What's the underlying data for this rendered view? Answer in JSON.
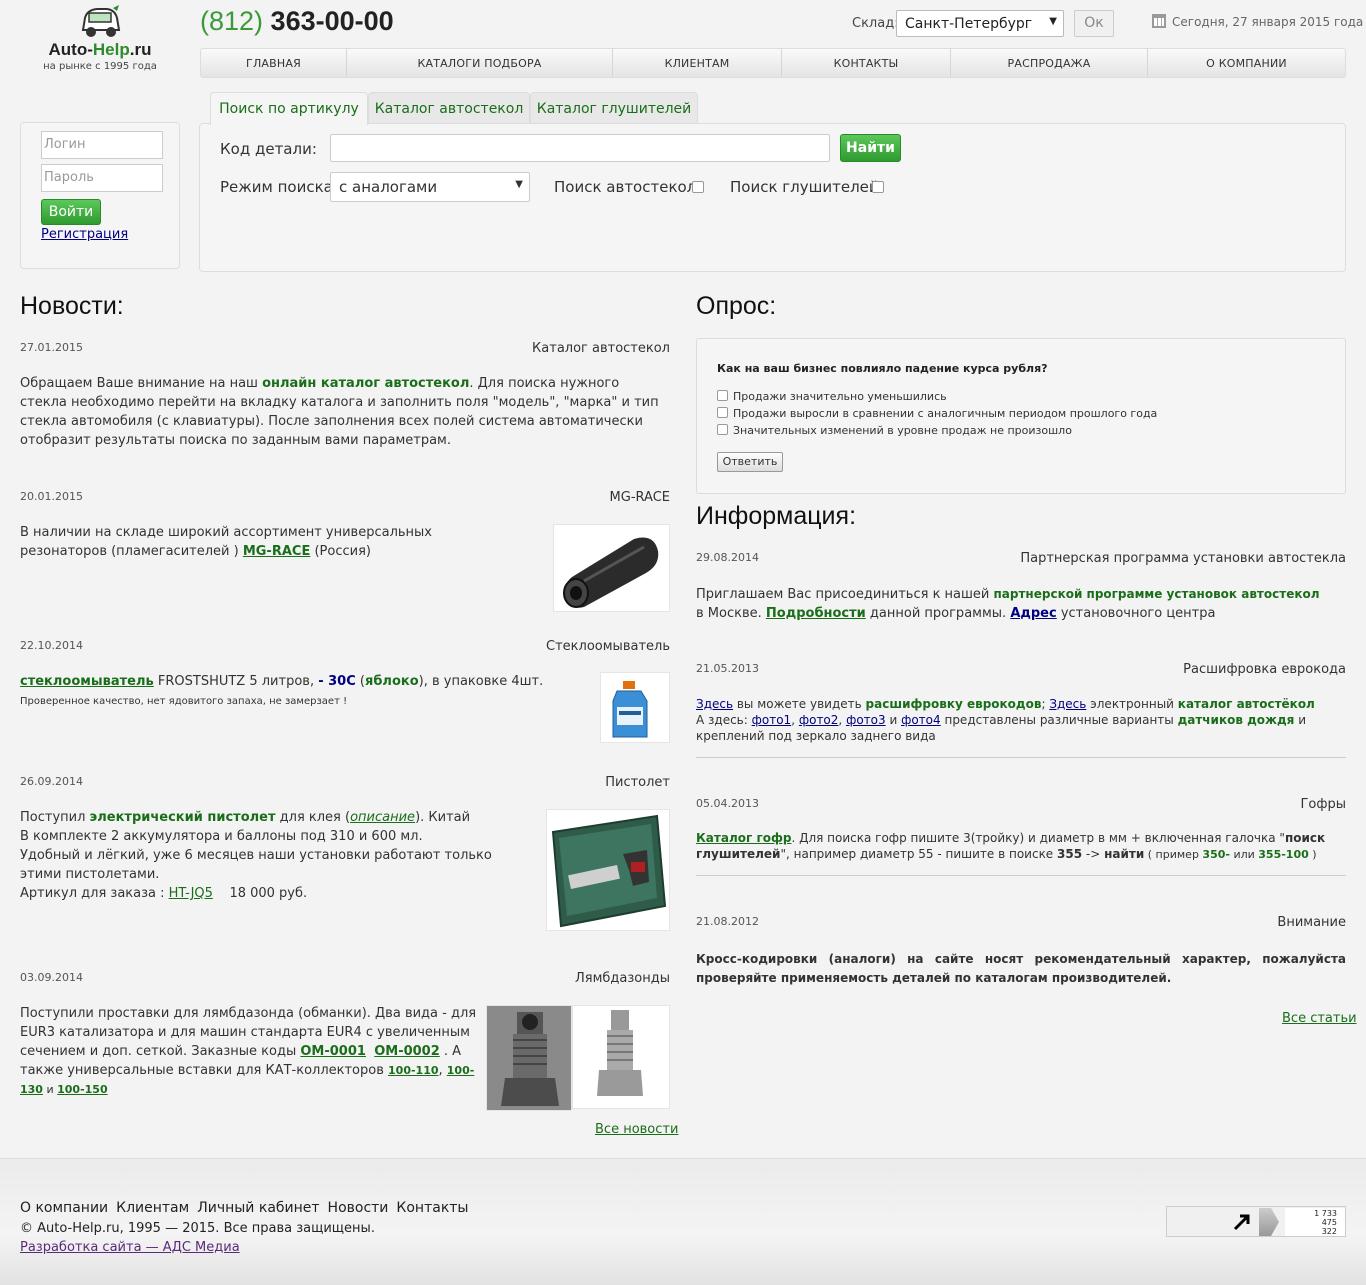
{
  "header": {
    "logo_name_a": "Auto-",
    "logo_name_b": "Help",
    "logo_name_c": ".ru",
    "logo_tagline": "на рынке с 1995 года",
    "phone_code": "(812)",
    "phone_number": "363-00-00",
    "warehouse_label": "Склад:",
    "warehouse_value": "Санкт-Петербург",
    "ok_label": "Ок",
    "date_text": "Сегодня, 27 января 2015 года"
  },
  "nav": [
    "ГЛАВНАЯ",
    "КАТАЛОГИ ПОДБОРА",
    "КЛИЕНТАМ",
    "КОНТАКТЫ",
    "РАСПРОДАЖА",
    "О КОМПАНИИ"
  ],
  "login": {
    "login_placeholder": "Логин",
    "password_placeholder": "Пароль",
    "submit_label": "Войти",
    "register_label": "Регистрация"
  },
  "tabs": [
    "Поиск по артикулу",
    "Каталог автостекол",
    "Каталог глушителей"
  ],
  "search": {
    "code_label": "Код детали:",
    "find_label": "Найти",
    "mode_label": "Режим поиска:",
    "mode_value": "с аналогами",
    "glass_label": "Поиск автостекол:",
    "muffler_label": "Поиск глушителей:"
  },
  "news": {
    "heading": "Новости:",
    "all_label": "Все новости",
    "items": [
      {
        "date": "27.01.2015",
        "title": "Каталог автостекол",
        "p1": "Обращаем Ваше внимание на наш ",
        "link": "онлайн каталог автостекол",
        "p2": ". Для поиска нужного стекла необходимо перейти на вкладку каталога  и заполнить поля \"модель\", \"марка\" и тип стекла автомобиля (с клавиатуры). После заполнения всех полей система автоматически отобразит результаты поиска по заданным вами параметрам."
      },
      {
        "date": "20.01.2015",
        "title": "MG-RACE",
        "p1": "В наличии на складе широкий ассортимент универсальных резонаторов (пламегасителей ) ",
        "link": "MG-RACE",
        "p2": " (Россия)"
      },
      {
        "date": "22.10.2014",
        "title": "Стеклоомыватель",
        "link": "стеклоомыватель",
        "p1": " FROSTSHUTZ 5 литров, ",
        "temp": "- 30С",
        "p2": " (",
        "apple": "яблоко",
        "p3": "), в упаковке 4шт.",
        "small": "Проверенное качество, нет ядовитого запаха, не замерзает !"
      },
      {
        "date": "26.09.2014",
        "title": "Пистолет",
        "p1": "Поступил ",
        "bold": "электрический пистолет",
        "p2": " для клея (",
        "link": "описание",
        "p3": "). Китай",
        "l2": "В комплекте 2 аккумулятора и баллоны под 310 и 600 мл.",
        "l3": "Удобный и лёгкий, уже 6 месяцев наши установки работают только этими пистолетами.",
        "l4a": "Артикул для заказа : ",
        "article": "HT-JQ5",
        "price": "18 000 руб."
      },
      {
        "date": "03.09.2014",
        "title": "Лямбдазонды",
        "p1": "Поступили проставки для лямбдазонда (обманки). Два вида - для EUR3 катализатора и для машин стандарта EUR4 с увеличенным сечением и доп. сеткой. Заказные коды ",
        "c1": "OM-0001",
        "c2": "OM-0002",
        "p2": " . А также универсальные вставки для КАТ-коллекторов ",
        "k1": "100-110",
        "k2": "100-130",
        "and": " и ",
        "k3": "100-150"
      }
    ]
  },
  "poll": {
    "heading": "Опрос:",
    "question": "Как на ваш бизнес повлияло падение курса рубля?",
    "options": [
      "Продажи значительно уменьшились",
      "Продажи выросли в сравнении с аналогичным периодом прошлого года",
      "Значительных изменений в уровне продаж не произошло"
    ],
    "submit_label": "Ответить"
  },
  "info": {
    "heading": "Информация:",
    "all_label": "Все статьи",
    "items": [
      {
        "date": "29.08.2014",
        "title": "Партнерская программа установки автостекла",
        "p1": "Приглашаем Вас присоединиться к нашей ",
        "b1": "партнерской программе установок автостекол",
        "p2": "в Москве. ",
        "link1": "Подробности",
        "p3": " данной программы. ",
        "link2": "Адрес",
        "p4": " установочного центра"
      },
      {
        "date": "21.05.2013",
        "title": "Расшифровка еврокода",
        "here1": "Здесь",
        "p1": " вы можете увидеть ",
        "b1": "расшифровку еврокодов",
        "p2": ";  ",
        "here2": "Здесь",
        "p3": " электронный ",
        "b2": "каталог автостёкол",
        "p4": "А здесь: ",
        "f1": "фото1",
        "f2": "фото2",
        "f3": "фото3",
        "and": " и ",
        "f4": "фото4",
        "p5": " представлены различные варианты ",
        "b3": "датчиков дождя",
        "p6": " и креплений под зеркало заднего вида"
      },
      {
        "date": "05.04.2013",
        "title": "Гофры",
        "link": "Каталог гофр",
        "p1": ". Для поиска гофр пишите 3(тройку) и диаметр в мм + включенная галочка \"",
        "b1": "поиск глушителей",
        "p2": "\", например диаметр 55 - пишите в поиске ",
        "b2": "355",
        "p3": " -> ",
        "b3": "найти",
        "p4": " ( пример ",
        "e1": "350-",
        "p5": " или ",
        "e2": "355-100",
        "p6": " )"
      },
      {
        "date": "21.08.2012",
        "title": "Внимание",
        "text": "Кросс-кодировки (аналоги) на сайте носят рекомендательный характер, пожалуйста проверяйте применяемость деталей по каталогам производителей."
      }
    ]
  },
  "footer": {
    "links": [
      "О компании",
      "Клиентам",
      "Личный кабинет",
      "Новости",
      "Контакты"
    ],
    "copyright": "© Auto-Help.ru, 1995 — 2015. Все права защищены.",
    "dev": "Разработка сайта — АДС Медиа",
    "counter": [
      "1 733",
      "475",
      "322"
    ]
  }
}
